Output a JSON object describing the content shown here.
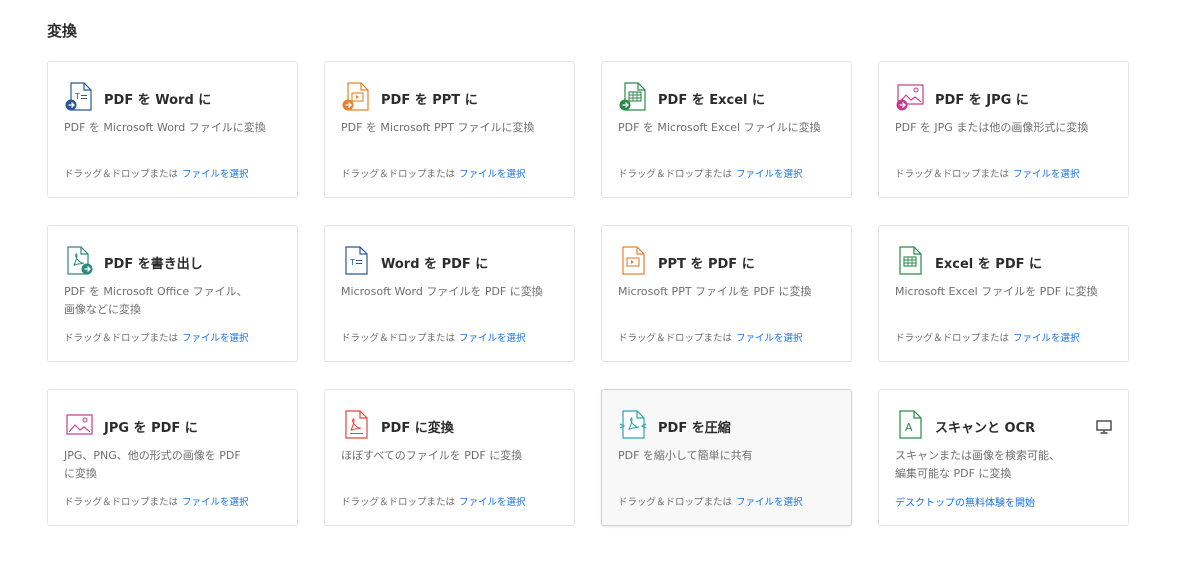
{
  "section": {
    "title": "変換"
  },
  "drop_text": "ドラッグ＆ドロップまたは",
  "select_link": "ファイルを選択",
  "cards": [
    {
      "title": "PDF を Word に",
      "desc": "PDF を Microsoft Word ファイルに変換",
      "icon": "pdf-to-word-icon"
    },
    {
      "title": "PDF を PPT に",
      "desc": "PDF を Microsoft PPT ファイルに変換",
      "icon": "pdf-to-ppt-icon"
    },
    {
      "title": "PDF を Excel に",
      "desc": "PDF を Microsoft Excel ファイルに変換",
      "icon": "pdf-to-excel-icon"
    },
    {
      "title": "PDF を JPG に",
      "desc": "PDF を JPG または他の画像形式に変換",
      "icon": "pdf-to-jpg-icon"
    },
    {
      "title": "PDF を書き出し",
      "desc": "PDF を Microsoft Office ファイル、\n画像などに変換",
      "icon": "export-pdf-icon"
    },
    {
      "title": "Word を PDF に",
      "desc": "Microsoft Word ファイルを PDF に変換",
      "icon": "word-to-pdf-icon"
    },
    {
      "title": "PPT を PDF に",
      "desc": "Microsoft PPT ファイルを PDF に変換",
      "icon": "ppt-to-pdf-icon"
    },
    {
      "title": "Excel を PDF に",
      "desc": "Microsoft Excel ファイルを PDF に変換",
      "icon": "excel-to-pdf-icon"
    },
    {
      "title": "JPG を PDF に",
      "desc": "JPG、PNG、他の形式の画像を PDF\nに変換",
      "icon": "jpg-to-pdf-icon"
    },
    {
      "title": "PDF に変換",
      "desc": "ほぼすべてのファイルを PDF に変換",
      "icon": "create-pdf-icon"
    },
    {
      "title": "PDF を圧縮",
      "desc": "PDF を縮小して簡単に共有",
      "icon": "compress-pdf-icon"
    },
    {
      "title": "スキャンと OCR",
      "desc": "スキャンまたは画像を検索可能、\n編集可能な PDF に変換",
      "icon": "scan-ocr-icon",
      "cta": "デスクトップの無料体験を開始",
      "badge_icon": "desktop-icon"
    }
  ],
  "colors": {
    "word": "#2b5797",
    "ppt": "#e5812a",
    "excel": "#2a8a4b",
    "jpg": "#c43a8a",
    "acrobat": "#e0453a",
    "compress": "#2aa3b5",
    "ocr": "#2a8a4b",
    "link": "#1473e6"
  }
}
